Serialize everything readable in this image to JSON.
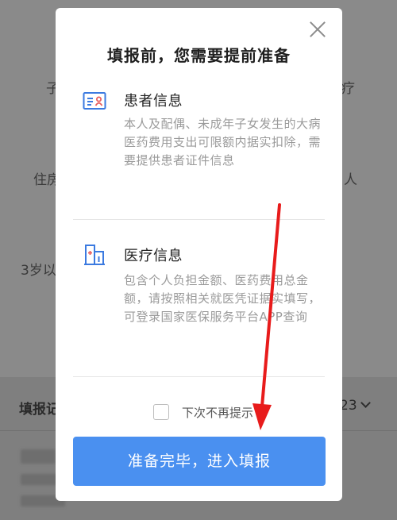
{
  "background": {
    "row1_left": "子",
    "row1_right": "疗",
    "row2_left": "住房",
    "row2_right": "人",
    "row3_left": "3岁以",
    "bottom_left": "填报记",
    "bottom_right": "23"
  },
  "modal": {
    "title": "填报前，您需要提前准备",
    "sections": [
      {
        "icon": "id-card-icon",
        "title": "患者信息",
        "description": "本人及配偶、未成年子女发生的大病医药费用支出可限额内据实扣除，需要提供患者证件信息"
      },
      {
        "icon": "hospital-building-icon",
        "title": "医疗信息",
        "description": "包含个人负担金额、医药费用总金额，请按照相关就医凭证据实填写，可登录国家医保服务平台APP查询"
      }
    ],
    "checkbox_label": "下次不再提示",
    "confirm_label": "准备完毕，进入填报"
  },
  "colors": {
    "accent": "#4a90f0",
    "icon_blue": "#3b7ae0",
    "icon_red": "#e85d5d",
    "annotation_arrow": "#e81b1b"
  }
}
